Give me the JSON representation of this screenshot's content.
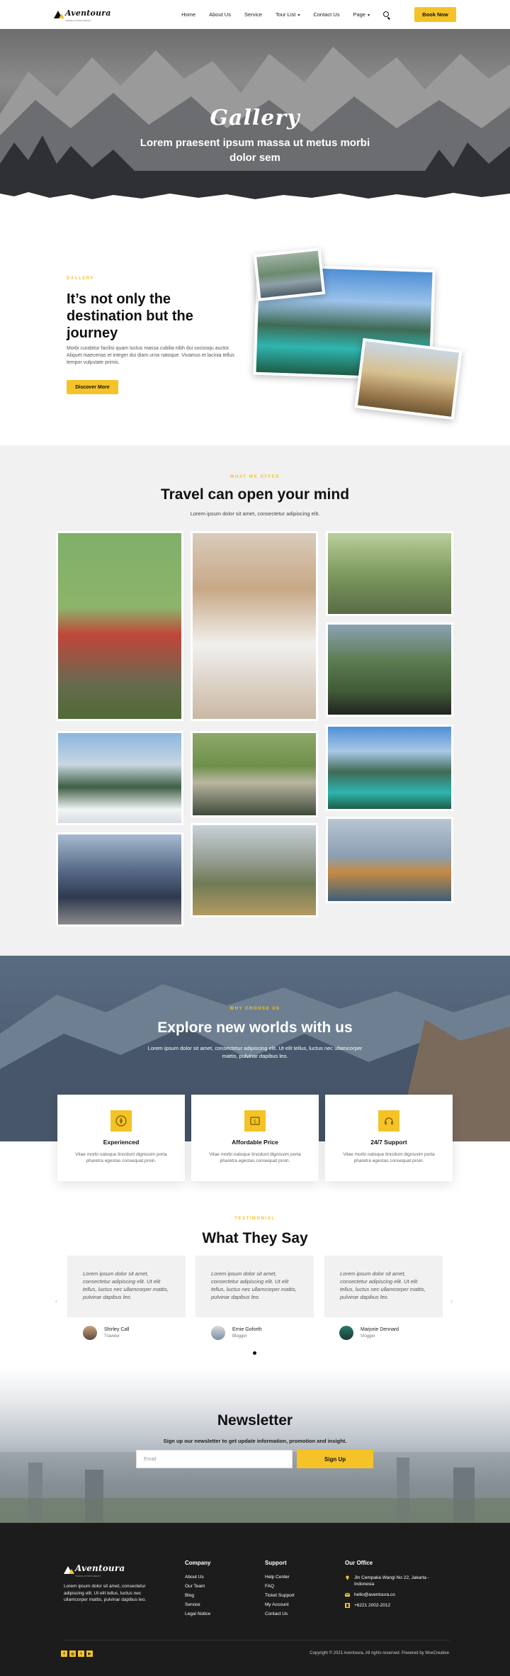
{
  "nav": {
    "brand": "Aventoura",
    "brand_tagline": "TRAVEL & TOUR AGENCY",
    "items": [
      {
        "label": "Home"
      },
      {
        "label": "About Us"
      },
      {
        "label": "Service"
      },
      {
        "label": "Tour List",
        "dropdown": true
      },
      {
        "label": "Contact Us"
      },
      {
        "label": "Page",
        "dropdown": true
      }
    ],
    "book_label": "Book Now"
  },
  "hero": {
    "title": "Gallery",
    "subtitle": "Lorem praesent ipsum massa ut metus morbi dolor sem"
  },
  "about": {
    "eyebrow": "GALLERY",
    "title": "It’s not only the destination but the journey",
    "body": "Morbi curabitur facilisi quam luctus massa cubilia nibh dui sociosqu auctor. Aliquet maecenas et integer dui diam urna natoque. Vivamus et lacinia tellus tempor vulputate primis.",
    "button": "Discover More"
  },
  "services": {
    "eyebrow": "WHAT WE OFFER",
    "title": "Travel can open your mind",
    "subtitle": "Lorem ipsum dolor sit amet, consectetur adipiscing elit."
  },
  "why": {
    "eyebrow": "WHY CHOOSE US",
    "title": "Explore new worlds with us",
    "subtitle": "Lorem ipsum dolor sit amet, consectetur adipiscing elit. Ut elit tellus, luctus nec ullamcorper mattis, pulvinar dapibus leo.",
    "features": [
      {
        "title": "Experienced",
        "text": "Vitae morbi natoque tincidunt dignissim porta pharetra egestas consequat proin.",
        "icon": "compass-icon"
      },
      {
        "title": "Affordable Price",
        "text": "Vitae morbi natoque tincidunt dignissim porta pharetra egestas consequat proin.",
        "icon": "price-tag-icon"
      },
      {
        "title": "24/7 Support",
        "text": "Vitae morbi natoque tincidunt dignissim porta pharetra egestas consequat proin.",
        "icon": "support-icon"
      }
    ]
  },
  "testimonials": {
    "eyebrow": "TESTIMONIAL",
    "title": "What They Say",
    "items": [
      {
        "quote": "Lorem ipsum dolor sit amet, consectetur adipiscing elit. Ut elit tellus, luctus nec ullamcorper mattis, pulvinar dapibus leo.",
        "name": "Shirley Call",
        "role": "Traveler"
      },
      {
        "quote": "Lorem ipsum dolor sit amet, consectetur adipiscing elit. Ut elit tellus, luctus nec ullamcorper mattis, pulvinar dapibus leo.",
        "name": "Ernie Goforth",
        "role": "Blogger"
      },
      {
        "quote": "Lorem ipsum dolor sit amet, consectetur adipiscing elit. Ut elit tellus, luctus nec ullamcorper mattis, pulvinar dapibus leo.",
        "name": "Marjorie Dennard",
        "role": "Vlogger"
      }
    ]
  },
  "newsletter": {
    "title": "Newsletter",
    "subtitle": "Sign up our newsletter to get update information, promotion and insight.",
    "placeholder": "Email",
    "button": "Sign Up"
  },
  "footer": {
    "brand": "Aventoura",
    "brand_tagline": "TRAVEL & TOUR AGENCY",
    "about": "Lorem ipsum dolor sit amet, consectetur adipiscing elit. Ut elit tellus, luctus nec ullamcorper mattis, pulvinar dapibus leo.",
    "company": {
      "title": "Company",
      "links": [
        "About Us",
        "Our Team",
        "Blog",
        "Service",
        "Legal Notice"
      ]
    },
    "support": {
      "title": "Support",
      "links": [
        "Help Center",
        "FAQ",
        "Ticket Support",
        "My Account",
        "Contact Us"
      ]
    },
    "office": {
      "title": "Our Office",
      "address": "Jln Cempaka Wangi No 22, Jakarta - Indonesia",
      "email": "hello@aventoura.co",
      "phone": "+6221 2002-2012"
    },
    "copyright": "Copyright © 2021 Aventoura, All rights reserved. Powered by MoxCreative"
  },
  "colors": {
    "accent": "#f5c327",
    "dark": "#1c1c1c"
  }
}
